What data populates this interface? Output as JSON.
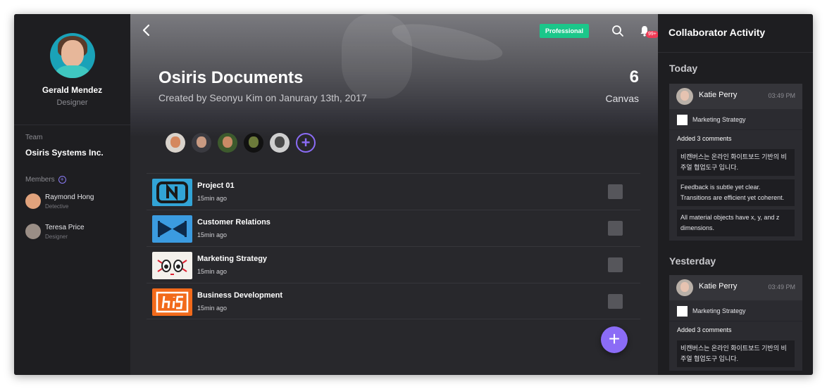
{
  "profile": {
    "name": "Gerald Mendez",
    "role": "Designer"
  },
  "team": {
    "label": "Team",
    "name": "Osiris Systems Inc."
  },
  "members": {
    "label": "Members",
    "items": [
      {
        "name": "Raymond Hong",
        "role": "Detective"
      },
      {
        "name": "Teresa Price",
        "role": "Designer"
      }
    ]
  },
  "header": {
    "plan_badge": "Professional",
    "notification_count": "99+",
    "title": "Osiris Documents",
    "subtitle": "Created by Seonyu Kim on Janurary 13th, 2017",
    "canvas_count": "6",
    "canvas_label": "Canvas"
  },
  "projects": [
    {
      "title": "Project 01",
      "time": "15min ago"
    },
    {
      "title": "Customer Relations",
      "time": "15min ago"
    },
    {
      "title": "Marketing Strategy",
      "time": "15min ago"
    },
    {
      "title": "Business Development",
      "time": "15min ago"
    }
  ],
  "activity": {
    "title": "Collaborator Activity",
    "days": [
      {
        "label": "Today",
        "user": "Katie Perry",
        "time": "03:49 PM",
        "canvas": "Marketing Strategy",
        "summary": "Added 3 comments",
        "comments": [
          "비캔버스는 온라인 화이트보드 기반의 비주얼 협업도구 입니다.",
          "Feedback is subtle yet clear. Transitions are efficient yet coherent.",
          "All material objects have x, y, and z dimensions."
        ]
      },
      {
        "label": "Yesterday",
        "user": "Katie Perry",
        "time": "03:49 PM",
        "canvas": "Marketing Strategy",
        "summary": "Added 3 comments",
        "comments": [
          "비캔버스는 온라인 화이트보드 기반의 비주얼 협업도구 입니다."
        ]
      }
    ]
  },
  "colors": {
    "accent": "#8b6cf6",
    "badge_green": "#1bc78a",
    "notif_red": "#ef3a55"
  }
}
